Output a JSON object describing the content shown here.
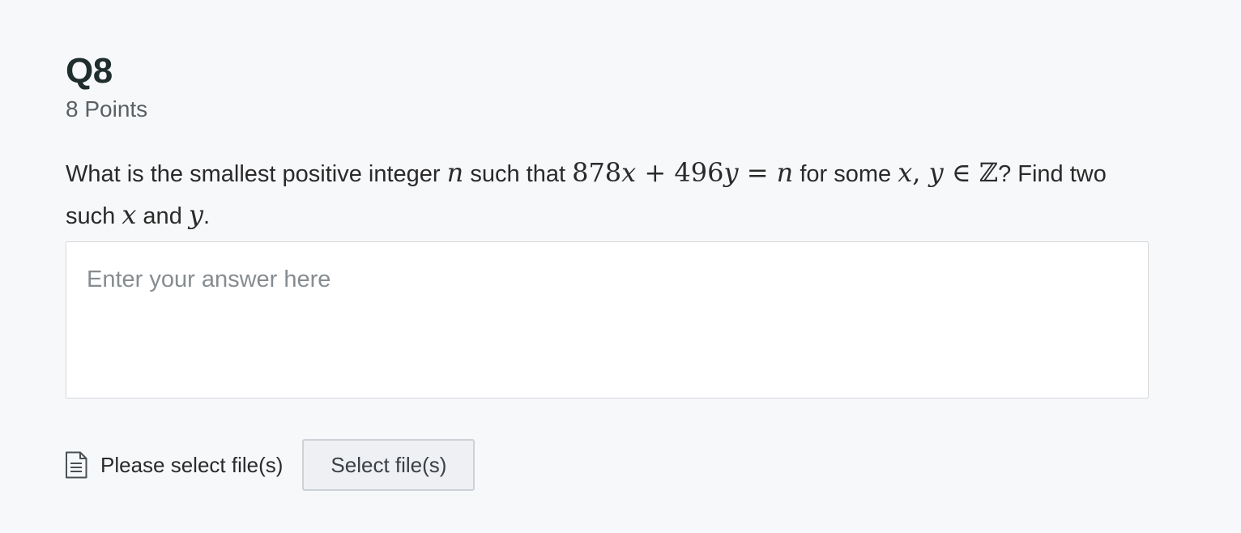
{
  "question": {
    "title": "Q8",
    "points": "8 Points",
    "prompt": {
      "t1": "What is the smallest positive integer ",
      "m1": "n",
      "t2": " such that ",
      "m2_a": "878",
      "m2_b": "x",
      "m2_c": " + 496",
      "m2_d": "y",
      "m2_e": " = ",
      "m2_f": "n",
      "t3": " for some ",
      "m3_a": "x",
      "m3_b": ", ",
      "m3_c": "y",
      "m3_d": " ∈ ℤ",
      "t4": "?  Find two such ",
      "m4": "x",
      "t5": " and ",
      "m5": "y",
      "t6": "."
    }
  },
  "answer": {
    "placeholder": "Enter your answer here",
    "value": ""
  },
  "files": {
    "icon": "document-icon",
    "label": "Please select file(s)",
    "button_label": "Select file(s)"
  }
}
